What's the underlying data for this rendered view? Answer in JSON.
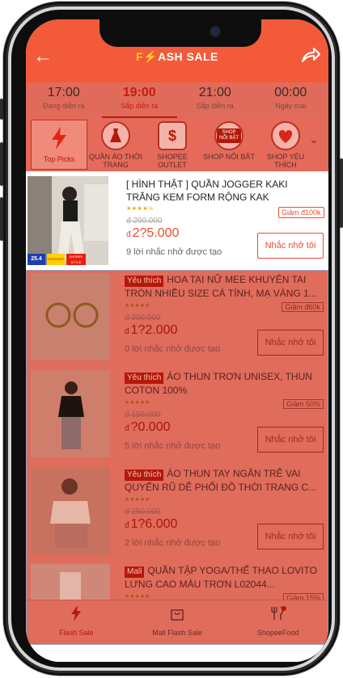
{
  "header": {
    "title_bolt": "F",
    "title_rest": "ASH SALE",
    "back_icon": "arrow-left-icon",
    "share_icon": "share-icon"
  },
  "time_tabs": [
    {
      "time": "17:00",
      "status": "Đang diễn ra",
      "active": false
    },
    {
      "time": "19:00",
      "status": "Sắp diễn ra",
      "active": true
    },
    {
      "time": "21:00",
      "status": "Sắp diễn ra",
      "active": false
    },
    {
      "time": "00:00",
      "status": "Ngày mai",
      "active": false
    }
  ],
  "categories": [
    {
      "label": "Top Picks",
      "icon": "lightning-icon",
      "active": true
    },
    {
      "label": "QUẦN ÁO THỜI TRANG",
      "icon": "dress-icon",
      "active": false
    },
    {
      "label": "SHOPEE OUTLET",
      "icon": "dollar-icon",
      "active": false
    },
    {
      "label": "SHOP NỔI BẬT",
      "icon": "shop-badge-icon",
      "badge": "SHOP NỔI BẬT",
      "active": false
    },
    {
      "label": "SHOP YÊU THÍCH",
      "icon": "heart-hand-icon",
      "active": false
    }
  ],
  "highlighted_product": {
    "title": "[ HÌNH THẬT ] QUẦN JOGGER KAKI TRẮNG KEM FORM RỘNG KAK",
    "stars": "★★★★½",
    "voucher": "Giảm đ100k",
    "old_price": "đ 290.000",
    "currency": "đ",
    "price": "2?5.000",
    "reminders": "9 lời nhắc nhở được tạo",
    "remind_button": "Nhắc nhở tôi",
    "badge_date": "25.4",
    "badge_ship": "FREESHIP",
    "badge_shopee": "SHOPEE STYLE"
  },
  "products": [
    {
      "tag": "Yêu thích",
      "title": "HOA TAI NỮ MEE KHUYÊN TAI TRÒN NHIỀU SIZE CÁ TÍNH, MẠ VÀNG 1...",
      "stars": "★★★★★",
      "voucher": "Giảm đ60k",
      "old_price": "đ 200.000",
      "currency": "đ",
      "price": "1?2.000",
      "reminders": "0 lời nhắc nhở được tạo",
      "button": "Nhắc nhở tôi"
    },
    {
      "tag": "Yêu thích",
      "title": "ÁO THUN TRƠN UNISEX, THUN COTON 100%",
      "stars": "★★★★★",
      "voucher": "Giảm 50%",
      "old_price": "đ 150.000",
      "currency": "đ",
      "price": "?0.000",
      "reminders": "5 lời nhắc nhở được tạo",
      "button": "Nhắc nhở tôi"
    },
    {
      "tag": "Yêu thích",
      "title": "ÁO THUN TAY NGẮN TRỄ VAI QUYẾN RŨ DỄ PHỐI ĐỒ THỜI TRANG C...",
      "stars": "★★★★★",
      "voucher": "",
      "old_price": "đ 250.000",
      "currency": "đ",
      "price": "1?6.000",
      "reminders": "2 lời nhắc nhở được tạo",
      "button": "Nhắc nhở tôi"
    },
    {
      "tag": "Mall",
      "title": "QUẦN TẬP YOGA/THỂ THAO LOVITO LƯNG CAO MÀU TRƠN L02044...",
      "stars": "★★★★★",
      "voucher": "Giảm 15%",
      "old_price": "",
      "currency": "",
      "price": "",
      "reminders": "",
      "button": ""
    }
  ],
  "bottom_nav": [
    {
      "label": "Flash Sale",
      "icon": "lightning-icon",
      "active": true
    },
    {
      "label": "Mall Flash Sale",
      "icon": "shopping-bag-icon",
      "active": false
    },
    {
      "label": "ShopeeFood",
      "icon": "fork-knife-icon",
      "active": false
    }
  ],
  "colors": {
    "brand": "#ee4d2d",
    "header": "#f25a3a",
    "dim_overlay": "#e06c5c"
  }
}
